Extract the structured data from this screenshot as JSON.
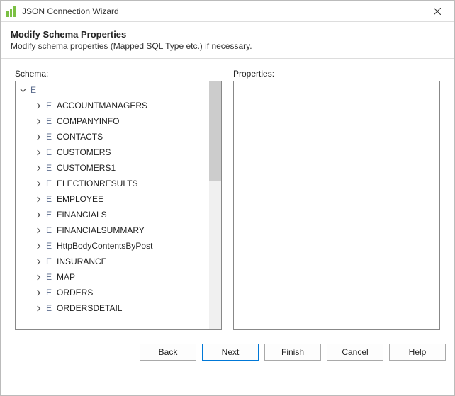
{
  "window": {
    "title": "JSON Connection Wizard",
    "close_icon": "close"
  },
  "header": {
    "title": "Modify Schema Properties",
    "description": "Modify schema properties (Mapped SQL Type etc.) if necessary."
  },
  "schema": {
    "label": "Schema:",
    "root": {
      "marker": "E",
      "name": "",
      "expanded": true
    },
    "items": [
      {
        "marker": "E",
        "name": "ACCOUNTMANAGERS"
      },
      {
        "marker": "E",
        "name": "COMPANYINFO"
      },
      {
        "marker": "E",
        "name": "CONTACTS"
      },
      {
        "marker": "E",
        "name": "CUSTOMERS"
      },
      {
        "marker": "E",
        "name": "CUSTOMERS1"
      },
      {
        "marker": "E",
        "name": "ELECTIONRESULTS"
      },
      {
        "marker": "E",
        "name": "EMPLOYEE"
      },
      {
        "marker": "E",
        "name": "FINANCIALS"
      },
      {
        "marker": "E",
        "name": "FINANCIALSUMMARY"
      },
      {
        "marker": "E",
        "name": "HttpBodyContentsByPost"
      },
      {
        "marker": "E",
        "name": "INSURANCE"
      },
      {
        "marker": "E",
        "name": "MAP"
      },
      {
        "marker": "E",
        "name": "ORDERS"
      },
      {
        "marker": "E",
        "name": "ORDERSDETAIL"
      }
    ]
  },
  "properties": {
    "label": "Properties:"
  },
  "buttons": {
    "back": "Back",
    "next": "Next",
    "finish": "Finish",
    "cancel": "Cancel",
    "help": "Help"
  }
}
